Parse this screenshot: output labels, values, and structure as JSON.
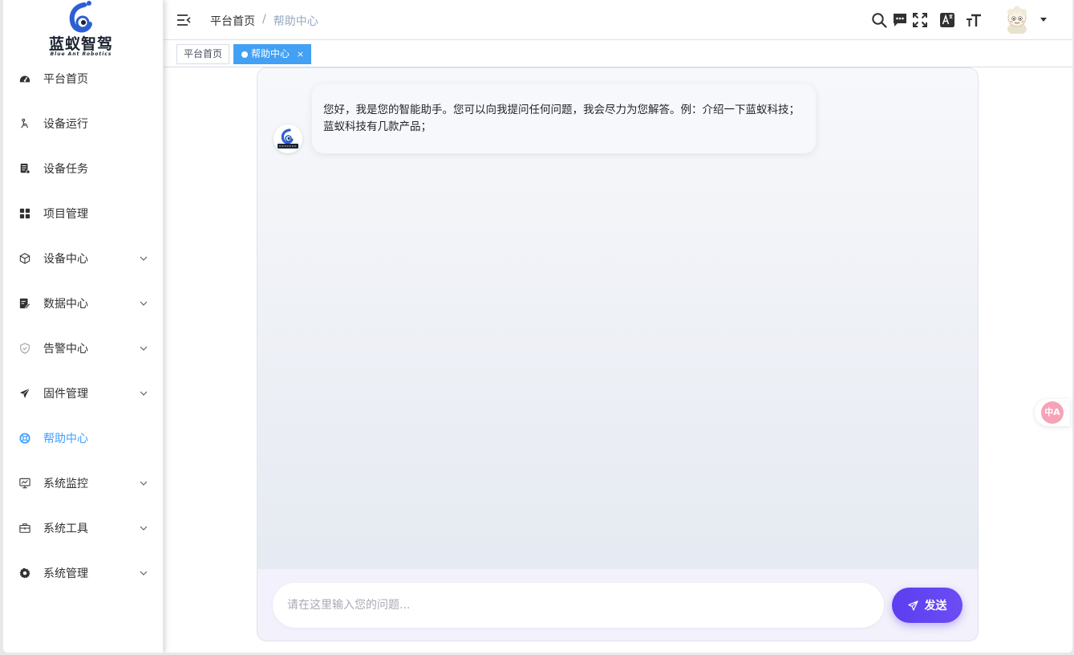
{
  "logo": {
    "text": "蓝蚁智驾",
    "subtext": "Blue Ant Robotics"
  },
  "sidebar": {
    "items": [
      {
        "label": "平台首页",
        "icon": "dashboard-icon",
        "expandable": false
      },
      {
        "label": "设备运行",
        "icon": "device-run-icon",
        "expandable": false
      },
      {
        "label": "设备任务",
        "icon": "task-icon",
        "expandable": false
      },
      {
        "label": "项目管理",
        "icon": "grid-icon",
        "expandable": false
      },
      {
        "label": "设备中心",
        "icon": "cube-icon",
        "expandable": true
      },
      {
        "label": "数据中心",
        "icon": "data-edit-icon",
        "expandable": true
      },
      {
        "label": "告警中心",
        "icon": "shield-icon",
        "expandable": true
      },
      {
        "label": "固件管理",
        "icon": "paper-plane-icon",
        "expandable": true
      },
      {
        "label": "帮助中心",
        "icon": "help-icon",
        "expandable": false,
        "active": true
      },
      {
        "label": "系统监控",
        "icon": "monitor-icon",
        "expandable": true
      },
      {
        "label": "系统工具",
        "icon": "toolbox-icon",
        "expandable": true
      },
      {
        "label": "系统管理",
        "icon": "gear-icon",
        "expandable": true
      }
    ]
  },
  "navbar": {
    "breadcrumb": {
      "home": "平台首页",
      "separator": "/",
      "current": "帮助中心"
    },
    "icons": [
      "search-icon",
      "chat-icon",
      "fullscreen-icon",
      "translate-icon",
      "font-size-icon"
    ]
  },
  "tags": [
    {
      "label": "平台首页",
      "active": false
    },
    {
      "label": "帮助中心",
      "active": true,
      "close": "×"
    }
  ],
  "chat": {
    "messages": [
      {
        "from": "bot",
        "text": "您好，我是您的智能助手。您可以向我提问任何问题，我会尽力为您解答。例：介绍一下蓝蚁科技；蓝蚁科技有几款产品；"
      }
    ],
    "input_placeholder": "请在这里输入您的问题...",
    "input_value": "",
    "send_label": "发送"
  },
  "float_button": {
    "label": "中A"
  },
  "colors": {
    "active": "#409eff",
    "tag_active": "#42a0f5",
    "send": "#5b3ef0"
  }
}
